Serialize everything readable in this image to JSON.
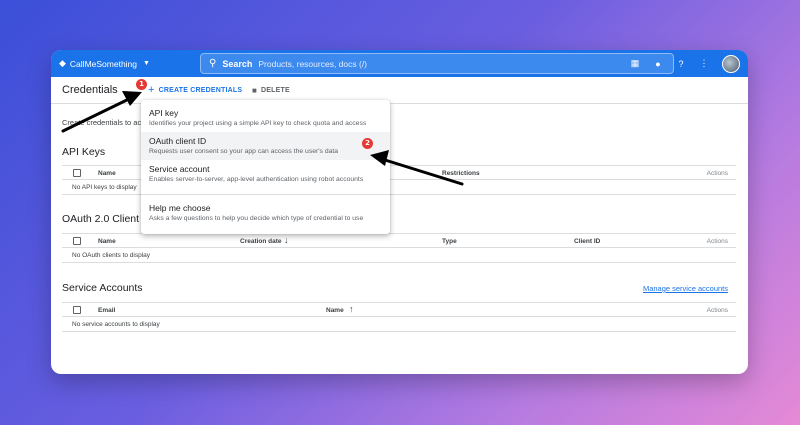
{
  "topbar": {
    "project_name": "CallMeSomething",
    "search_label": "Search",
    "search_placeholder": "Products, resources, docs (/)",
    "icons": [
      "terminal-icon",
      "bell-icon",
      "help-icon",
      "more-icon"
    ]
  },
  "toolbar": {
    "title": "Credentials",
    "create_label": "CREATE CREDENTIALS",
    "delete_label": "DELETE"
  },
  "intro_text": "Create credentials to acc",
  "api_keys": {
    "title": "API Keys",
    "columns": [
      "Name",
      "Restrictions",
      "Actions"
    ],
    "empty": "No API keys to display"
  },
  "oauth": {
    "title": "OAuth 2.0 Client I",
    "columns": [
      "Name",
      "Creation date",
      "Type",
      "Client ID",
      "Actions"
    ],
    "empty": "No OAuth clients to display"
  },
  "service_accounts": {
    "title": "Service Accounts",
    "manage_link": "Manage service accounts",
    "columns": [
      "Email",
      "Name",
      "Actions"
    ],
    "empty": "No service accounts to display"
  },
  "menu": {
    "items": [
      {
        "title": "API key",
        "desc": "Identifies your project using a simple API key to check quota and access"
      },
      {
        "title": "OAuth client ID",
        "desc": "Requests user consent so your app can access the user's data"
      },
      {
        "title": "Service account",
        "desc": "Enables server-to-server, app-level authentication using robot accounts"
      },
      {
        "title": "Help me choose",
        "desc": "Asks a few questions to help you decide which type of credential to use"
      }
    ]
  },
  "badges": [
    "1",
    "2"
  ],
  "colors": {
    "accent": "#1a73e8",
    "badge": "#e53935"
  }
}
